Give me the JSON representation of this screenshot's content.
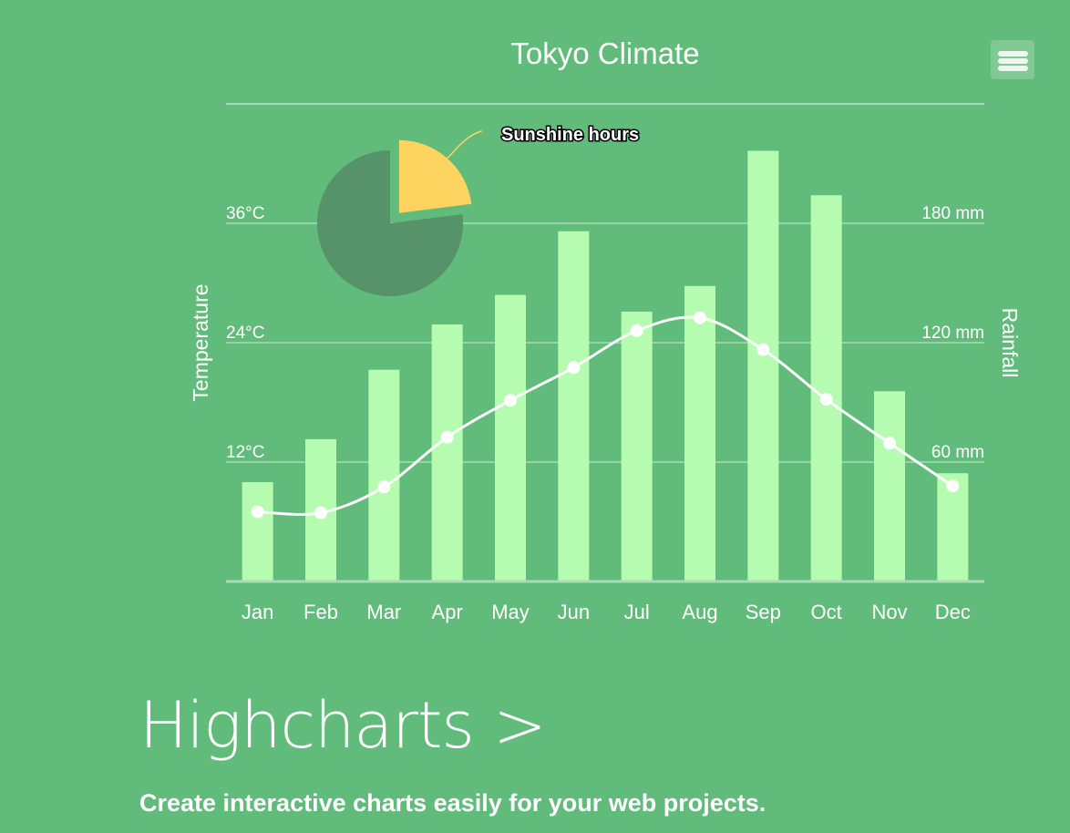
{
  "chart_data": {
    "type": "bar+line+pie",
    "title": "Tokyo Climate",
    "categories": [
      "Jan",
      "Feb",
      "Mar",
      "Apr",
      "May",
      "Jun",
      "Jul",
      "Aug",
      "Sep",
      "Oct",
      "Nov",
      "Dec"
    ],
    "series": [
      {
        "name": "Rainfall",
        "type": "bar",
        "axis": "right",
        "values": [
          49.9,
          71.5,
          106.4,
          129.2,
          144.0,
          176.0,
          135.6,
          148.5,
          216.4,
          194.1,
          95.6,
          54.4
        ],
        "color": "#b5fcb1"
      },
      {
        "name": "Temperature",
        "type": "line",
        "axis": "left",
        "values": [
          7.0,
          6.9,
          9.5,
          14.5,
          18.2,
          21.5,
          25.2,
          26.5,
          23.3,
          18.3,
          13.9,
          9.6
        ],
        "color": "#ffffff"
      }
    ],
    "pie": {
      "slices": [
        {
          "name": "Sunshine hours",
          "value": 23,
          "color": "#fed461"
        },
        {
          "value": 77,
          "color": "#56936b"
        }
      ]
    },
    "y_left": {
      "label": "Temperature",
      "ticks": [
        {
          "v": 12,
          "t": "12°C"
        },
        {
          "v": 24,
          "t": "24°C"
        },
        {
          "v": 36,
          "t": "36°C"
        }
      ],
      "range": [
        0,
        48
      ]
    },
    "y_right": {
      "label": "Rainfall",
      "ticks": [
        {
          "v": 60,
          "t": "60 mm"
        },
        {
          "v": 120,
          "t": "120 mm"
        },
        {
          "v": 180,
          "t": "180 mm"
        }
      ],
      "range": [
        0,
        240
      ]
    },
    "grid": true
  },
  "menu": {
    "icon": "hamburger-menu-icon"
  },
  "hero": {
    "title": "Highcharts >",
    "tagline": "Create interactive charts easily for your web projects."
  }
}
